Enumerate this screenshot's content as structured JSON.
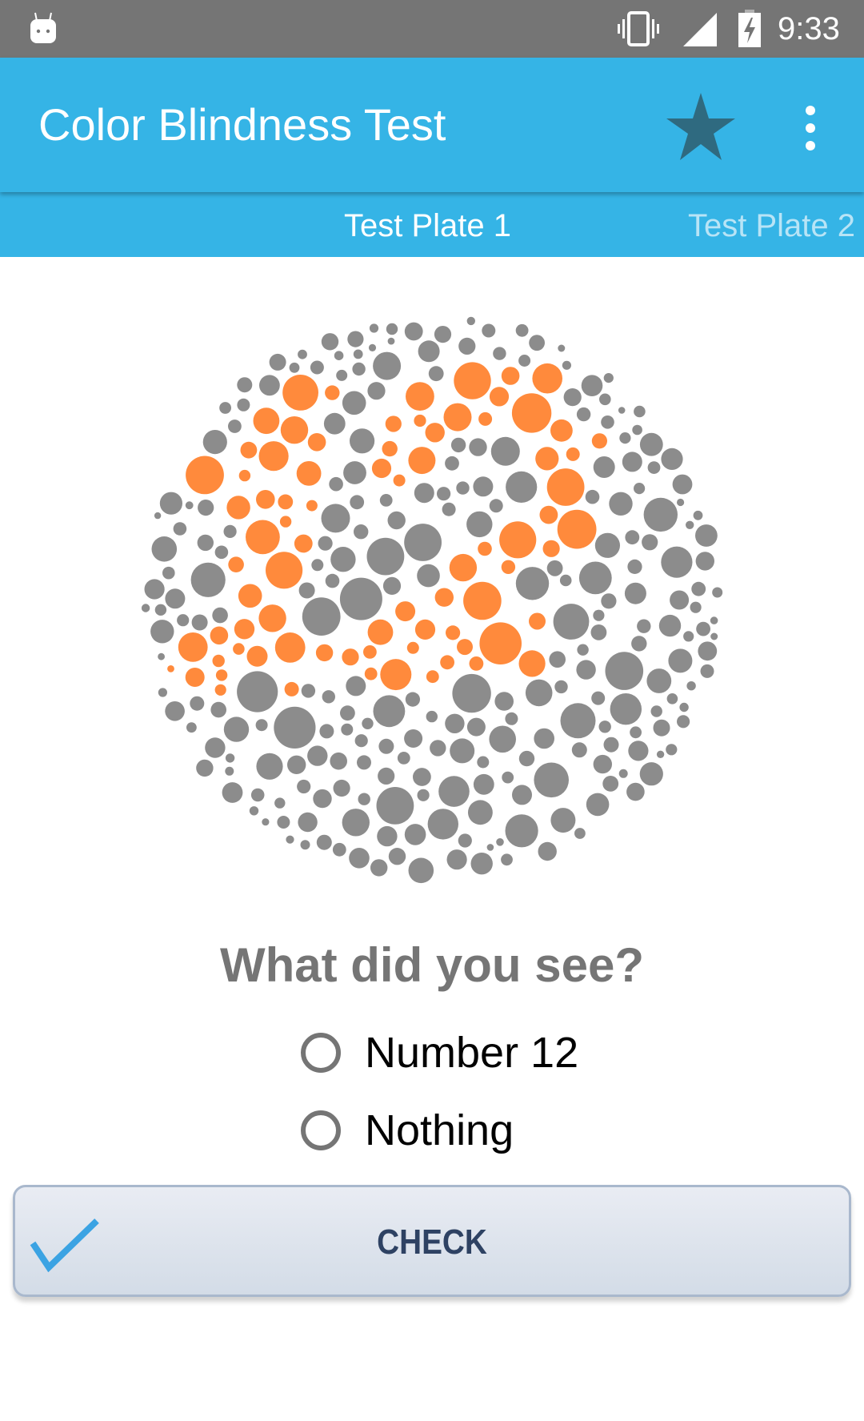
{
  "status_bar": {
    "time": "9:33",
    "icons": [
      "android-debug-icon",
      "vibrate-icon",
      "signal-icon",
      "battery-charging-icon"
    ]
  },
  "app_bar": {
    "title": "Color Blindness Test",
    "actions": [
      "star-icon",
      "overflow-menu-icon"
    ]
  },
  "colors": {
    "status_bar": "#757575",
    "app_bar": "#35b4e6",
    "star": "#2f6a80",
    "tab_active": "#ffffff",
    "tab_inactive": "#b8e4f6",
    "plate_dot_gray": "#8c8c8c",
    "plate_dot_orange": "#ff8a3c",
    "question_text": "#757575",
    "check_icon": "#3ba3e3",
    "check_text": "#2e4263"
  },
  "tabs": [
    {
      "label": "Test Plate 1",
      "active": true
    },
    {
      "label": "Test Plate 2",
      "active": false
    }
  ],
  "plate": {
    "description": "Ishihara color plate",
    "hidden_number": "12"
  },
  "question": "What did you see?",
  "options": [
    {
      "label": "Number 12",
      "selected": false
    },
    {
      "label": "Nothing",
      "selected": false
    }
  ],
  "check_button": {
    "label": "CHECK",
    "icon": "checkmark-icon"
  }
}
